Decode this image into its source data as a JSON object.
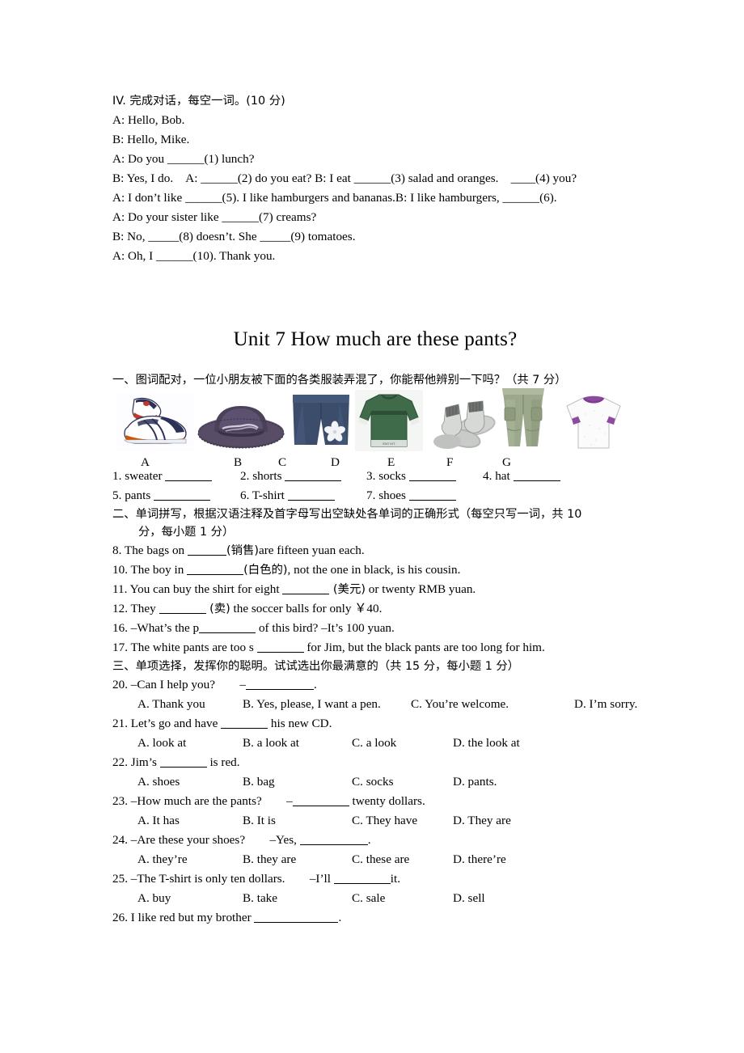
{
  "dialogue_section": {
    "heading": "IV. 完成对话，每空一词。(10 分)",
    "lines": [
      "A: Hello, Bob.",
      "B: Hello, Mike.",
      "A: Do you ______(1) lunch?",
      "B: Yes, I do.　A: ______(2) do you eat? B: I eat ______(3) salad and oranges.　____(4) you?",
      "A: I don’t like ______(5). I like hamburgers and bananas.B: I like hamburgers, ______(6).",
      "A: Do your sister like ______(7) creams?",
      "B: No, _____(8) doesn’t. She _____(9) tomatoes.",
      "A: Oh, I ______(10). Thank you."
    ]
  },
  "unit_title": "Unit 7 How much are these pants?",
  "section_one": {
    "heading": "一、图词配对，一位小朋友被下面的各类服装弄混了，你能帮他辨别一下吗？（共 7 分）",
    "pictures": [
      {
        "letter": "A",
        "item": "sneakers-image"
      },
      {
        "letter": "B",
        "item": "hat-image"
      },
      {
        "letter": "C",
        "item": "shorts-image"
      },
      {
        "letter": "D",
        "item": "sweater-image"
      },
      {
        "letter": "E",
        "item": "socks-image"
      },
      {
        "letter": "F",
        "item": "pants-image"
      },
      {
        "letter": "G",
        "item": "tshirt-image"
      }
    ],
    "match_row1": [
      {
        "num": "1.",
        "word": "sweater"
      },
      {
        "num": "2.",
        "word": "shorts"
      },
      {
        "num": "3.",
        "word": "socks"
      },
      {
        "num": "4.",
        "word": "hat"
      }
    ],
    "match_row2": [
      {
        "num": "5.",
        "word": "pants"
      },
      {
        "num": "6.",
        "word": "T-shirt"
      },
      {
        "num": "7.",
        "word": "shoes"
      }
    ]
  },
  "section_two": {
    "heading_line1": "二、单词拼写，根据汉语注释及首字母写出空缺处各单词的正确形式（每空只写一词，共 10",
    "heading_line2": "分，每小题 1 分）",
    "questions": [
      {
        "num": "8.",
        "pre": "The bags on ",
        "paren": "(销售)",
        "post": "are fifteen yuan each.",
        "blank": "b-s"
      },
      {
        "num": "10.",
        "pre": "The boy in ",
        "paren": "(白色的)",
        "post": ", not the one in black, is his cousin.",
        "blank": "b-l"
      },
      {
        "num": "11.",
        "pre": "You can buy the shirt for eight ",
        "paren": " (美元)",
        "post": " or twenty RMB yuan.",
        "blank": "b-m"
      },
      {
        "num": "12.",
        "pre": "They ",
        "paren": " (卖)",
        "post": " the soccer balls for only  ￥40.",
        "blank": "b-m"
      },
      {
        "num": "16.",
        "pre": "–What’s the p",
        "paren": "",
        "post": " of this bird?    –It’s 100 yuan.",
        "blank": "b-l"
      },
      {
        "num": "17.",
        "pre": "The white pants are too s ",
        "paren": "",
        "post": " for Jim, but the black pants are too long for him.",
        "blank": "b-m"
      }
    ]
  },
  "section_three": {
    "heading": "三、单项选择，发挥你的聪明。试试选出你最满意的（共 15 分，每小题 1 分）",
    "questions": [
      {
        "num": "20.",
        "stem_pre": "–Can I help you?　　–",
        "stem_post": ".",
        "blank": "b-xl",
        "layout": "wide",
        "options": [
          "A. Thank you",
          "B. Yes, please, I want a pen.",
          "C. You’re welcome.",
          "D. I’m sorry."
        ]
      },
      {
        "num": "21.",
        "stem_pre": "Let’s go and have ",
        "stem_post": " his new CD.",
        "blank": "b-m",
        "layout": "normal",
        "options": [
          "A. look at",
          "B. a look at",
          "C. a look",
          "D. the look at"
        ]
      },
      {
        "num": "22.",
        "stem_pre": "Jim’s ",
        "stem_post": " is red.",
        "blank": "b-m",
        "layout": "normal",
        "options": [
          "A. shoes",
          "B. bag",
          "C. socks",
          "D. pants."
        ]
      },
      {
        "num": "23.",
        "stem_pre": "–How much are the pants?　　–",
        "stem_post": " twenty dollars.",
        "blank": "b-l",
        "layout": "normal",
        "options": [
          "A. It has",
          "B. It is",
          "C. They have",
          "D. They are"
        ]
      },
      {
        "num": "24.",
        "stem_pre": "–Are these your shoes?　　–Yes, ",
        "stem_post": ".",
        "blank": "b-xl",
        "layout": "normal",
        "options": [
          "A. they’re",
          "B. they are",
          "C. these are",
          "D. there’re"
        ]
      },
      {
        "num": "25.",
        "stem_pre": "–The T-shirt is only ten dollars.　　–I’ll ",
        "stem_post": "it.",
        "blank": "b-l",
        "layout": "normal",
        "options": [
          "A. buy",
          "B. take",
          "C. sale",
          "D. sell"
        ]
      },
      {
        "num": "26.",
        "stem_pre": "I like red but my brother ",
        "stem_post": ".",
        "blank": "b-xxl",
        "layout": "none",
        "options": []
      }
    ]
  }
}
